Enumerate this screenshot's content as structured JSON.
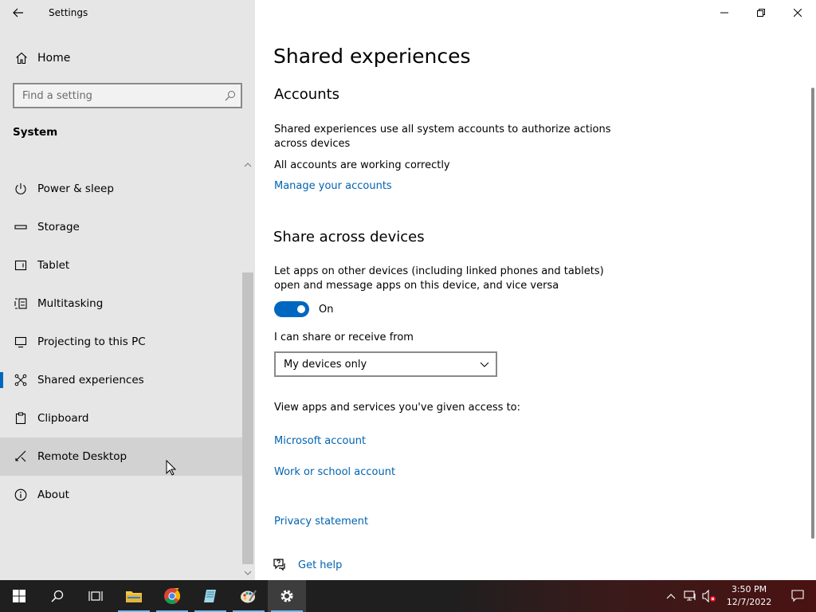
{
  "window": {
    "title": "Settings"
  },
  "sidebar": {
    "home_label": "Home",
    "search_placeholder": "Find a setting",
    "section": "System",
    "items": [
      {
        "label": "Power & sleep",
        "icon": "power-icon"
      },
      {
        "label": "Storage",
        "icon": "storage-icon"
      },
      {
        "label": "Tablet",
        "icon": "tablet-icon"
      },
      {
        "label": "Multitasking",
        "icon": "multitasking-icon"
      },
      {
        "label": "Projecting to this PC",
        "icon": "projecting-icon"
      },
      {
        "label": "Shared experiences",
        "icon": "shared-experiences-icon",
        "selected": true
      },
      {
        "label": "Clipboard",
        "icon": "clipboard-icon"
      },
      {
        "label": "Remote Desktop",
        "icon": "remote-desktop-icon",
        "hovered": true
      },
      {
        "label": "About",
        "icon": "info-icon"
      }
    ]
  },
  "main": {
    "title": "Shared experiences",
    "accounts": {
      "heading": "Accounts",
      "description": "Shared experiences use all system accounts to authorize actions across devices",
      "status": "All accounts are working correctly",
      "link": "Manage your accounts"
    },
    "share": {
      "heading": "Share across devices",
      "description": "Let apps on other devices (including linked phones and tablets) open and message apps on this device, and vice versa",
      "toggle_state": "On",
      "share_label": "I can share or receive from",
      "select_value": "My devices only",
      "access_label": "View apps and services you've given access to:",
      "link_microsoft": "Microsoft account",
      "link_work": "Work or school account"
    },
    "privacy_link": "Privacy statement",
    "help_link": "Get help"
  },
  "taskbar": {
    "time": "3:50 PM",
    "date": "12/7/2022"
  },
  "colors": {
    "accent": "#0067c0",
    "link": "#0063b1",
    "sidebar_bg": "#e6e6e6"
  }
}
